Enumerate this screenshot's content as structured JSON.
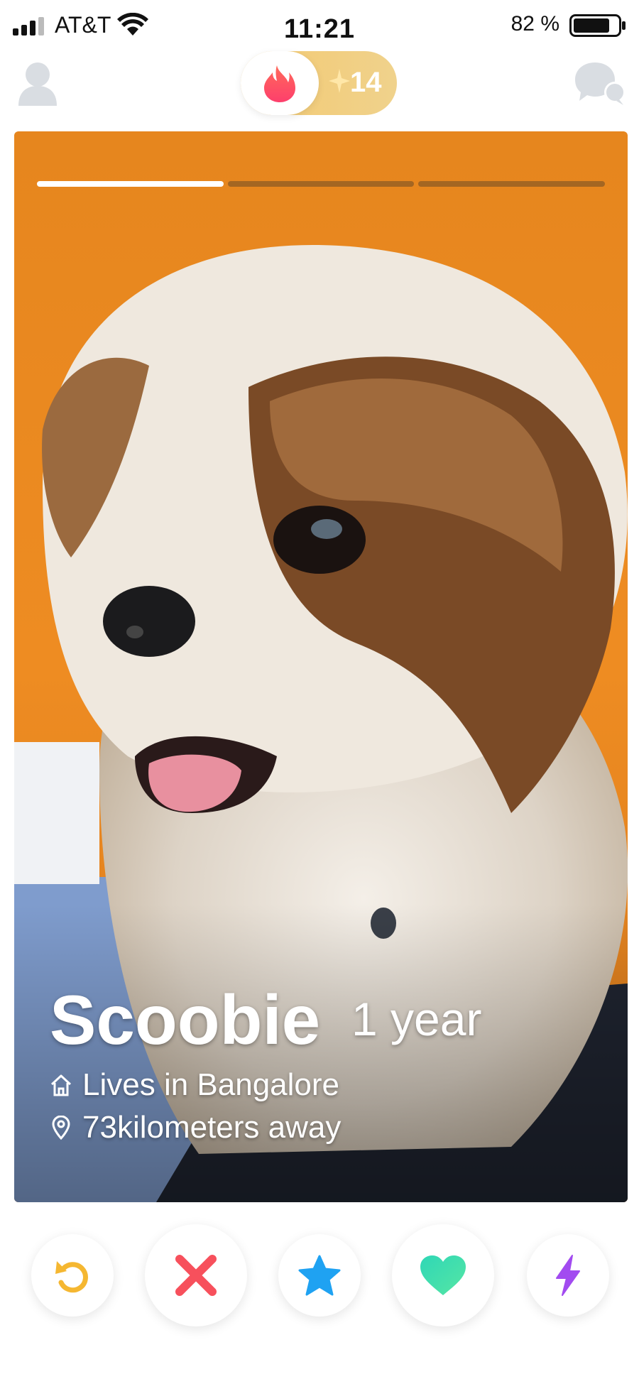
{
  "status_bar": {
    "carrier": "AT&T",
    "time": "11:21",
    "battery_percent": "82 %",
    "battery_level": 0.82
  },
  "header": {
    "profile_icon": "user-icon",
    "mode_icon": "flame-icon",
    "gold_count": "14",
    "messages_icon": "chat-bubbles-icon"
  },
  "card": {
    "photo_pages": 3,
    "active_photo_index": 0,
    "name": "Scoobie",
    "age": "1 year",
    "lives_in": "Lives in Bangalore",
    "distance": "73kilometers away"
  },
  "actions": [
    {
      "name": "rewind",
      "icon": "rewind-icon",
      "color": "#f5b731"
    },
    {
      "name": "nope",
      "icon": "close-icon",
      "color": "#f7505c"
    },
    {
      "name": "super-like",
      "icon": "star-icon",
      "color": "#1fa2f2"
    },
    {
      "name": "like",
      "icon": "heart-icon",
      "color": "#3fe0b3"
    },
    {
      "name": "boost",
      "icon": "lightning-icon",
      "color": "#a24bf0"
    }
  ],
  "colors": {
    "brand": "#fd4f66",
    "gold": "#f0c96f",
    "background": "#ffffff"
  }
}
